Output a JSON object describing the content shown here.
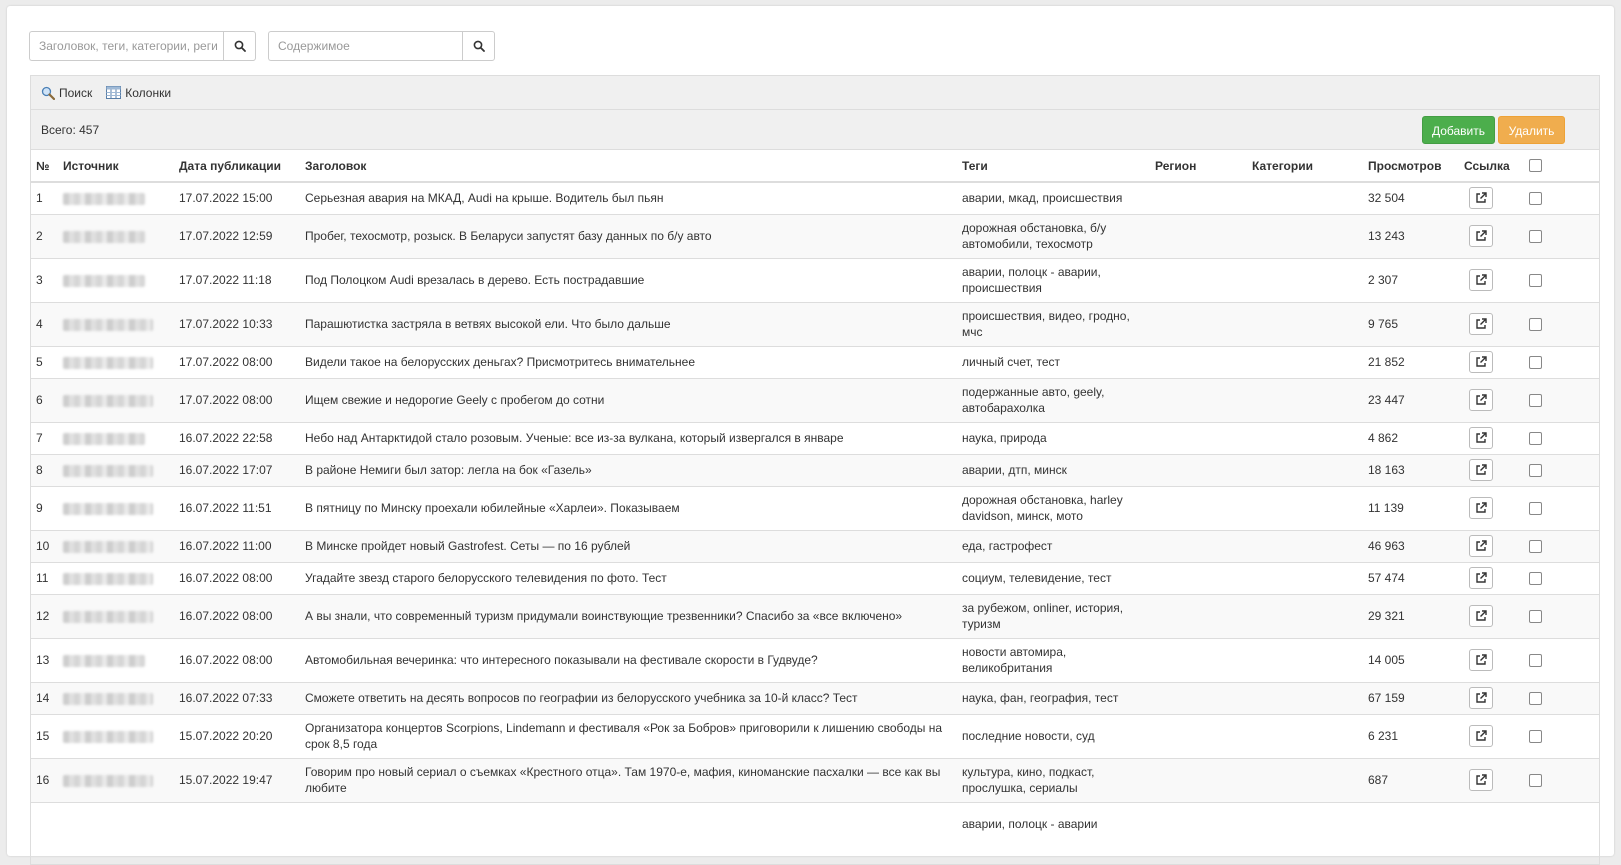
{
  "search": {
    "title_placeholder": "Заголовок, теги, категории, реги",
    "content_placeholder": "Содержимое"
  },
  "toolbar": {
    "search_label": "Поиск",
    "columns_label": "Колонки"
  },
  "summary": {
    "total_label": "Всего: 457"
  },
  "actions": {
    "add_label": "Добавить",
    "delete_label": "Удалить"
  },
  "table": {
    "headers": {
      "num": "№",
      "source": "Источник",
      "date": "Дата публикации",
      "title": "Заголовок",
      "tags": "Теги",
      "region": "Регион",
      "categories": "Категории",
      "views": "Просмотров",
      "link": "Ссылка"
    },
    "rows": [
      {
        "num": "1",
        "date": "17.07.2022 15:00",
        "title": "Серьезная авария на МКАД, Audi на крыше. Водитель был пьян",
        "tags": "аварии, мкад, происшествия",
        "views": "32 504"
      },
      {
        "num": "2",
        "date": "17.07.2022 12:59",
        "title": "Пробег, техосмотр, розыск. В Беларуси запустят базу данных по б/у авто",
        "tags": "дорожная обстановка, б/у автомобили, техосмотр",
        "views": "13 243"
      },
      {
        "num": "3",
        "date": "17.07.2022 11:18",
        "title": "Под Полоцком Audi врезалась в дерево. Есть пострадавшие",
        "tags": "аварии, полоцк - аварии, происшествия",
        "views": "2 307"
      },
      {
        "num": "4",
        "date": "17.07.2022 10:33",
        "title": "Парашютистка застряла в ветвях высокой ели. Что было дальше",
        "tags": "происшествия, видео, гродно, мчс",
        "views": "9 765"
      },
      {
        "num": "5",
        "date": "17.07.2022 08:00",
        "title": "Видели такое на белорусских деньгах? Присмотритесь внимательнее",
        "tags": "личный счет, тест",
        "views": "21 852"
      },
      {
        "num": "6",
        "date": "17.07.2022 08:00",
        "title": "Ищем свежие и недорогие Geely с пробегом до сотни",
        "tags": "подержанные авто, geely, автобарахолка",
        "views": "23 447"
      },
      {
        "num": "7",
        "date": "16.07.2022 22:58",
        "title": "Небо над Антарктидой стало розовым. Ученые: все из-за вулкана, который извергался в январе",
        "tags": "наука, природа",
        "views": "4 862"
      },
      {
        "num": "8",
        "date": "16.07.2022 17:07",
        "title": "В районе Немиги был затор: легла на бок «Газель»",
        "tags": "аварии, дтп, минск",
        "views": "18 163"
      },
      {
        "num": "9",
        "date": "16.07.2022 11:51",
        "title": "В пятницу по Минску проехали юбилейные «Харлеи». Показываем",
        "tags": "дорожная обстановка, harley davidson, минск, мото",
        "views": "11 139"
      },
      {
        "num": "10",
        "date": "16.07.2022 11:00",
        "title": "В Минске пройдет новый Gastrofest. Сеты — по 16 рублей",
        "tags": "еда, гастрофест",
        "views": "46 963"
      },
      {
        "num": "11",
        "date": "16.07.2022 08:00",
        "title": "Угадайте звезд старого белорусского телевидения по фото. Тест",
        "tags": "социум, телевидение, тест",
        "views": "57 474"
      },
      {
        "num": "12",
        "date": "16.07.2022 08:00",
        "title": "А вы знали, что современный туризм придумали воинствующие трезвенники? Спасибо за «все включено»",
        "tags": "за рубежом, onliner, история, туризм",
        "views": "29 321"
      },
      {
        "num": "13",
        "date": "16.07.2022 08:00",
        "title": "Автомобильная вечеринка: что интересного показывали на фестивале скорости в Гудвуде?",
        "tags": "новости автомира, великобритания",
        "views": "14 005"
      },
      {
        "num": "14",
        "date": "16.07.2022 07:33",
        "title": "Сможете ответить на десять вопросов по географии из белорусского учебника за 10-й класс? Тест",
        "tags": "наука, фан, география, тест",
        "views": "67 159"
      },
      {
        "num": "15",
        "date": "15.07.2022 20:20",
        "title": "Организатора концертов Scorpions, Lindemann и фестиваля «Рок за Бобров» приговорили к лишению свободы на срок 8,5 года",
        "tags": "последние новости, суд",
        "views": "6 231"
      },
      {
        "num": "16",
        "date": "15.07.2022 19:47",
        "title": "Говорим про новый сериал о съемках «Крестного отца». Там 1970-е, мафия, киноманские пасхалки — все как вы любите",
        "tags": "культура, кино, подкаст, прослушка, сериалы",
        "views": "687"
      },
      {
        "num": "",
        "date": "",
        "title": "",
        "tags": "аварии, полоцк - аварии",
        "views": ""
      }
    ]
  },
  "colors": {
    "add": "#4cae4c",
    "delete": "#f0ad4e",
    "border": "#dddddd",
    "toolbar_bg": "#f0f0f0"
  }
}
